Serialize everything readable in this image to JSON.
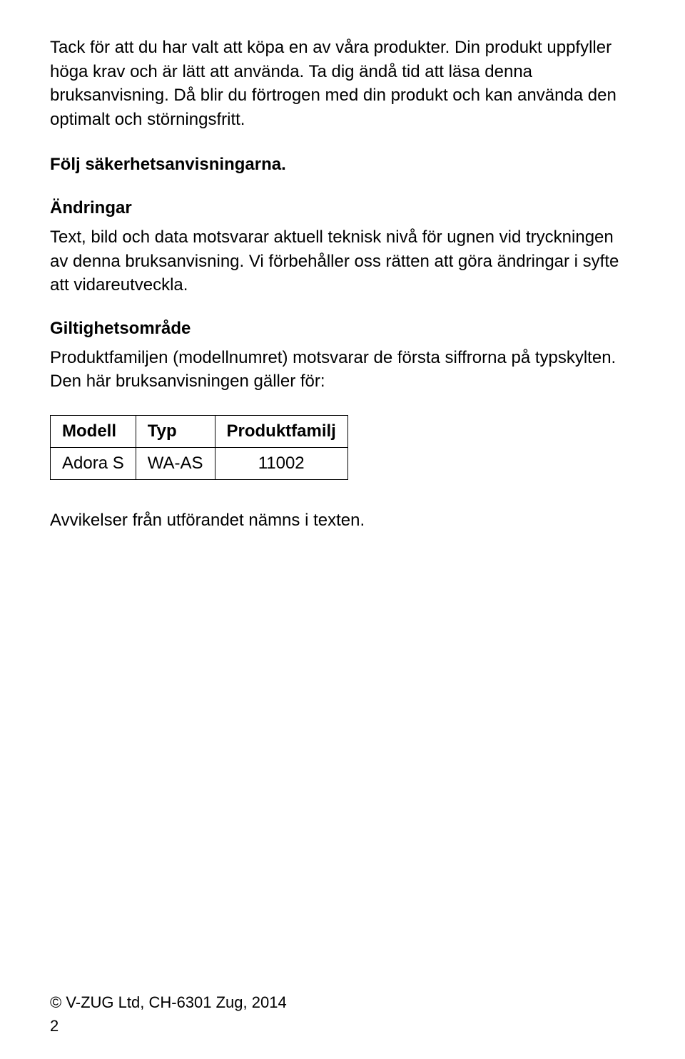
{
  "intro": {
    "paragraph1": "Tack för att du har valt att köpa en av våra produkter. Din produkt uppfyller höga krav och är lätt att använda. Ta dig ändå tid att läsa denna bruksanvisning. Då blir du förtrogen med din produkt och kan använda den optimalt och störningsfritt.",
    "paragraph2": "Följ säkerhetsanvisningarna."
  },
  "changes": {
    "heading": "Ändringar",
    "text": "Text, bild och data motsvarar aktuell teknisk nivå för ugnen vid tryckningen av denna bruksanvisning. Vi förbehåller oss rätten att göra ändringar i syfte att vidareutveckla."
  },
  "validity": {
    "heading": "Giltighetsområde",
    "text": "Produktfamiljen (modellnumret) motsvarar de första siffrorna på typskylten. Den här bruksanvisningen gäller för:"
  },
  "table": {
    "headers": {
      "col1": "Modell",
      "col2": "Typ",
      "col3": "Produktfamilj"
    },
    "row": {
      "model": "Adora S",
      "type": "WA-AS",
      "family": "11002"
    }
  },
  "deviations": "Avvikelser från utförandet nämns i texten.",
  "footer": {
    "copyright": "© V-ZUG Ltd, CH-6301 Zug, 2014",
    "page": "2"
  }
}
